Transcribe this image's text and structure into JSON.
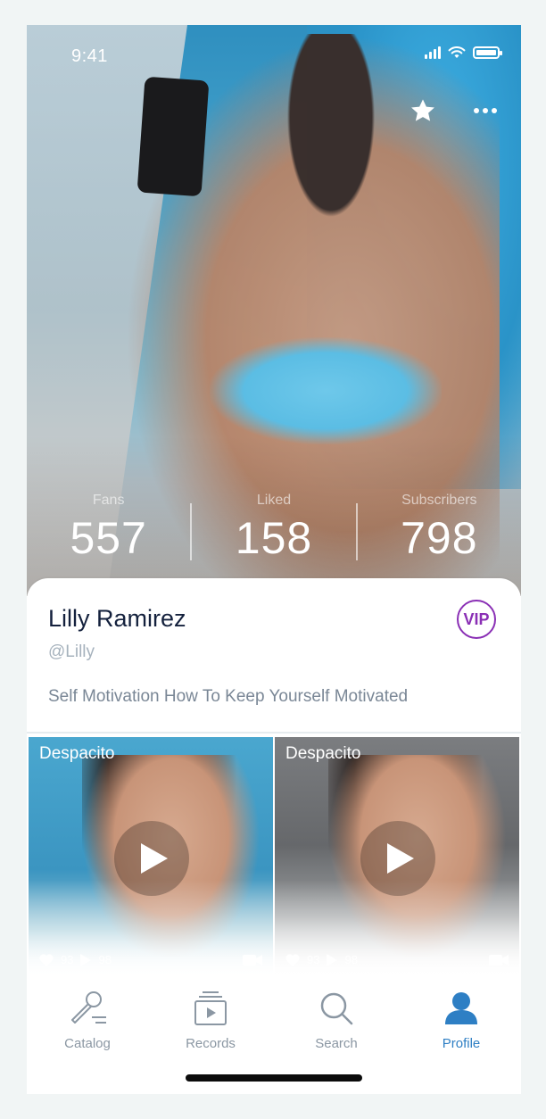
{
  "status": {
    "time": "9:41"
  },
  "profile": {
    "name": "Lilly Ramirez",
    "handle": "@Lilly",
    "bio": "Self Motivation How To Keep Yourself Motivated",
    "badge": "VIP"
  },
  "stats": [
    {
      "label": "Fans",
      "value": "557"
    },
    {
      "label": "Liked",
      "value": "158"
    },
    {
      "label": "Subscribers",
      "value": "798"
    }
  ],
  "videos": [
    {
      "title": "Despacito",
      "likes": "93",
      "plays": "98"
    },
    {
      "title": "Despacito",
      "likes": "93",
      "plays": "98"
    }
  ],
  "tabs": [
    {
      "label": "Catalog",
      "icon": "microphone-icon"
    },
    {
      "label": "Records",
      "icon": "records-icon"
    },
    {
      "label": "Search",
      "icon": "search-icon"
    },
    {
      "label": "Profile",
      "icon": "profile-icon",
      "active": true
    }
  ],
  "colors": {
    "accent": "#2e7fc4",
    "vip": "#8a2fb5",
    "name": "#14213d"
  }
}
